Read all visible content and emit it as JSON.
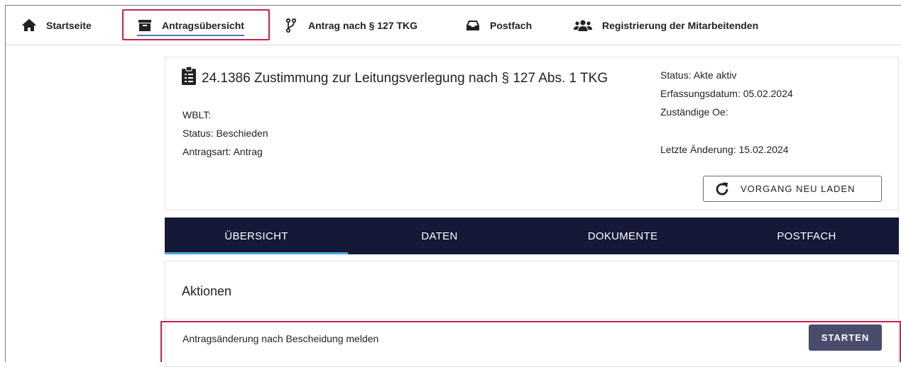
{
  "nav": {
    "items": [
      {
        "label": "Startseite",
        "icon": "home-icon"
      },
      {
        "label": "Antragsübersicht",
        "icon": "archive-box-icon"
      },
      {
        "label": "Antrag nach § 127 TKG",
        "icon": "branch-icon"
      },
      {
        "label": "Postfach",
        "icon": "inbox-icon"
      },
      {
        "label": "Registrierung der Mitarbeitenden",
        "icon": "users-icon"
      }
    ],
    "active_index": 1
  },
  "record": {
    "title": "24.1386 Zustimmung zur Leitungsverlegung nach § 127 Abs. 1 TKG",
    "wblt": "WBLT:",
    "status": "Status: Beschieden",
    "antragsart": "Antragsart: Antrag",
    "akte_status": "Status: Akte aktiv",
    "erfassungsdatum": "Erfassungsdatum: 05.02.2024",
    "zustaendige_oe": "Zuständige Oe:",
    "letzte_aenderung": "Letzte Änderung: 15.02.2024",
    "reload_label": "VORGANG NEU LADEN"
  },
  "tabs": [
    "ÜBERSICHT",
    "DATEN",
    "DOKUMENTE",
    "POSTFACH"
  ],
  "actions": {
    "title": "Aktionen",
    "items": [
      {
        "label": "Antragsänderung nach Bescheidung melden",
        "button": "STARTEN"
      }
    ]
  },
  "colors": {
    "tabbar": "#151837",
    "tab_indicator": "#4aa8e0",
    "highlight": "#c8214f",
    "start_button": "#4a4c6b"
  }
}
